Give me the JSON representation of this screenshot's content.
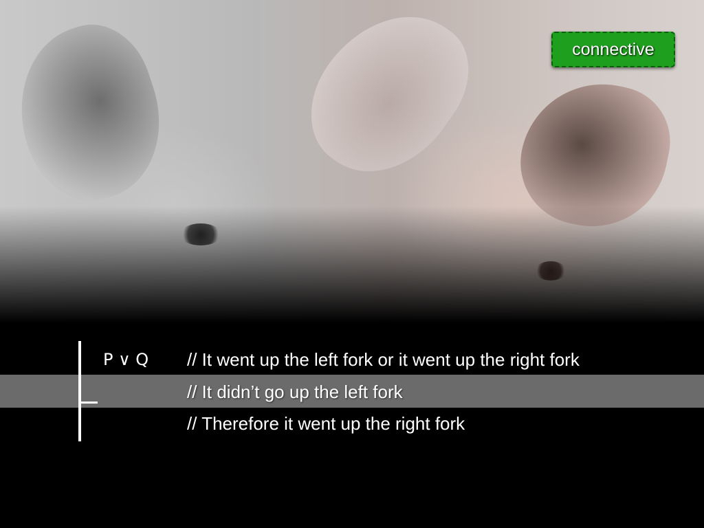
{
  "tag": {
    "label": "connective"
  },
  "colors": {
    "tag_background": "#1ea01e",
    "highlight_band": "#6b6b6b",
    "background": "#000000",
    "text": "#ffffff"
  },
  "proof": {
    "rows": [
      {
        "formula": "P ∨ Q",
        "comment": "// It went up the left fork or it went up the right fork"
      },
      {
        "formula": "",
        "comment": "// It didn’t go up the left fork"
      },
      {
        "formula": "",
        "comment": "// Therefore it went up the right fork"
      }
    ]
  },
  "image": {
    "subject_icon": "pigs-photo"
  }
}
